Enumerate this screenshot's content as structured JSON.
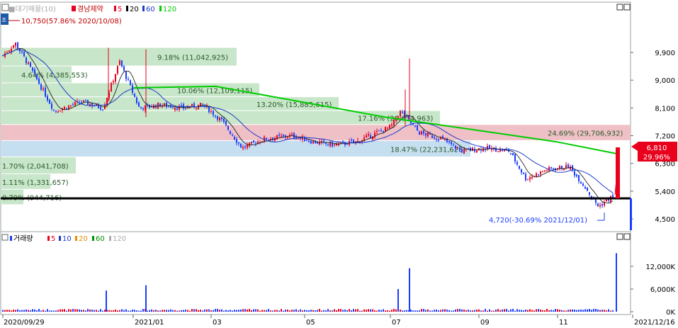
{
  "price_panel": {
    "legend": {
      "prefix": "■대기매물(10)",
      "stock_name": "경남제약",
      "ma5": "5",
      "ma20": "20",
      "ma60": "60",
      "ma120": "120"
    },
    "high_label": "10,750(57.86% 2020/10/08)",
    "low_label": "4,720(-30.69% 2021/12/01)",
    "current_price": "6,810",
    "current_change": "29.96%",
    "y_ticks": [
      "9,900",
      "9,000",
      "8,100",
      "7,200",
      "6,300",
      "5,400",
      "4,500"
    ],
    "volume_profile": [
      {
        "label": "9.18% (11,042,925)",
        "color": "#c8e6c9"
      },
      {
        "label": "4.64% (4,385,553)",
        "color": "#c8e6c9"
      },
      {
        "label": "10.06% (12,109,115)",
        "color": "#c8e6c9"
      },
      {
        "label": "13.20% (15,885,615)",
        "color": "#c8e6c9"
      },
      {
        "label": "17.16% (20,654,963)",
        "color": "#c8e6c9"
      },
      {
        "label": "24.69% (29,706,932)",
        "color": "#efc0c6"
      },
      {
        "label": "18.47% (22,231,628)",
        "color": "#c6dff0"
      },
      {
        "label": "1.70% (2,041,708)",
        "color": "#c8e6c9"
      },
      {
        "label": "1.11% (1,331,657)",
        "color": "#c8e6c9"
      },
      {
        "label": "0.79% (944,716)",
        "color": "#c8e6c9"
      }
    ]
  },
  "volume_panel": {
    "legend": {
      "title": "거래량",
      "ma5": "5",
      "ma10": "10",
      "ma20": "20",
      "ma60": "60",
      "ma120": "120"
    },
    "y_ticks": [
      "12,000K",
      "6,000K",
      "0K"
    ]
  },
  "x_axis": {
    "ticks": [
      "2020/09/29",
      "2021/01",
      "03",
      "05",
      "07",
      "09",
      "11",
      "2021/12/16"
    ]
  },
  "colors": {
    "up": "#e8001c",
    "down": "#1a3cff",
    "ma5": "#e8001c",
    "ma20": "#000000",
    "ma60": "#1e3cc8",
    "ma120": "#00cc00",
    "support_line": "#000000"
  },
  "chart_data": {
    "type": "candlestick",
    "title": "경남제약",
    "x_range": [
      "2020/09/29",
      "2021/12/16"
    ],
    "ylim": [
      4300,
      10400
    ],
    "key_points": [
      {
        "date": "2020/10/08",
        "price": 10750,
        "note": "high"
      },
      {
        "date": "2021/12/01",
        "price": 4720,
        "note": "low"
      },
      {
        "date": "2021/12/16",
        "price": 6810,
        "change_pct": 29.96
      }
    ],
    "approx_close_path": [
      {
        "x": "2020/09/29",
        "y": 9800
      },
      {
        "x": "2020/10/08",
        "y": 10200
      },
      {
        "x": "2020/10/20",
        "y": 9300
      },
      {
        "x": "2020/11/05",
        "y": 8000
      },
      {
        "x": "2020/11/25",
        "y": 8300
      },
      {
        "x": "2020/12/10",
        "y": 8100
      },
      {
        "x": "2020/12/22",
        "y": 9600
      },
      {
        "x": "2021/01/05",
        "y": 8100
      },
      {
        "x": "2021/01/20",
        "y": 8200
      },
      {
        "x": "2021/02/05",
        "y": 8100
      },
      {
        "x": "2021/02/20",
        "y": 8200
      },
      {
        "x": "2021/03/05",
        "y": 7700
      },
      {
        "x": "2021/03/20",
        "y": 6800
      },
      {
        "x": "2021/04/05",
        "y": 7100
      },
      {
        "x": "2021/04/25",
        "y": 7200
      },
      {
        "x": "2021/05/10",
        "y": 7000
      },
      {
        "x": "2021/05/25",
        "y": 6900
      },
      {
        "x": "2021/06/10",
        "y": 7000
      },
      {
        "x": "2021/06/25",
        "y": 7300
      },
      {
        "x": "2021/07/05",
        "y": 7500
      },
      {
        "x": "2021/07/12",
        "y": 8000
      },
      {
        "x": "2021/07/25",
        "y": 7300
      },
      {
        "x": "2021/08/10",
        "y": 7100
      },
      {
        "x": "2021/08/25",
        "y": 6700
      },
      {
        "x": "2021/09/10",
        "y": 6800
      },
      {
        "x": "2021/09/28",
        "y": 6700
      },
      {
        "x": "2021/10/10",
        "y": 5800
      },
      {
        "x": "2021/10/25",
        "y": 6100
      },
      {
        "x": "2021/11/10",
        "y": 6200
      },
      {
        "x": "2021/11/22",
        "y": 5500
      },
      {
        "x": "2021/12/01",
        "y": 4900
      },
      {
        "x": "2021/12/10",
        "y": 5200
      },
      {
        "x": "2021/12/15",
        "y": 5250
      },
      {
        "x": "2021/12/16",
        "y": 6810
      }
    ],
    "ma120_path": [
      {
        "x": "2021/01",
        "y": 8750
      },
      {
        "x": "2021/03",
        "y": 8800
      },
      {
        "x": "2021/05",
        "y": 8300
      },
      {
        "x": "2021/07",
        "y": 7800
      },
      {
        "x": "2021/09",
        "y": 7400
      },
      {
        "x": "2021/11",
        "y": 7000
      },
      {
        "x": "2021/12/16",
        "y": 6600
      }
    ],
    "support_level": 5150
  }
}
